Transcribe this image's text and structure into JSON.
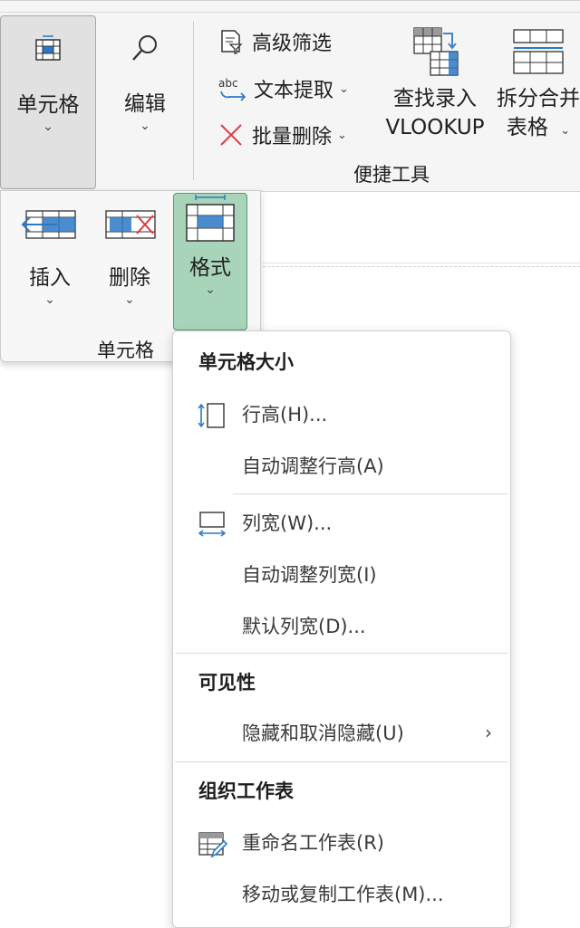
{
  "ribbon": {
    "cell_group_button": "单元格",
    "edit_button": "编辑",
    "advanced_filter": "高级筛选",
    "text_extract": "文本提取",
    "batch_delete": "批量删除",
    "vlookup_line1": "查找录入",
    "vlookup_line2": "VLOOKUP",
    "split_merge_line1": "拆分合并",
    "split_merge_line2": "表格",
    "convenience_group_label": "便捷工具"
  },
  "cell_panel": {
    "insert": "插入",
    "delete": "删除",
    "format": "格式",
    "group_label": "单元格"
  },
  "menu": {
    "section_cell_size": "单元格大小",
    "row_height": "行高(H)...",
    "autofit_row": "自动调整行高(A)",
    "col_width": "列宽(W)...",
    "autofit_col": "自动调整列宽(I)",
    "default_width": "默认列宽(D)...",
    "section_visibility": "可见性",
    "hide_unhide": "隐藏和取消隐藏(U)",
    "section_organize": "组织工作表",
    "rename_sheet": "重命名工作表(R)",
    "move_copy_sheet": "移动或复制工作表(M)..."
  },
  "colors": {
    "accent": "#2b78c4",
    "format_active": "#a8d4b9",
    "delete_red": "#e0393e"
  }
}
